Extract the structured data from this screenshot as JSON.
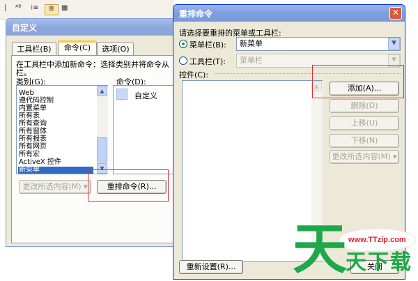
{
  "toolbar": {
    "sep": "|",
    "icon_abc": "ᴬᴮ",
    "icon_list": "⁝≡",
    "icon_grid": "▦"
  },
  "customize": {
    "title": "自定义",
    "tabs": [
      "工具栏(B)",
      "命令(C)",
      "选项(O)"
    ],
    "instruction": "在工具栏中添加新命令：选择类别并将命令从",
    "instruction2": "栏。",
    "category_label": "类别(G):",
    "commands_label": "命令(D):",
    "categories": [
      "Web",
      "遵代码控制",
      "内置菜单",
      "所有表",
      "所有查询",
      "所有窗体",
      "所有报表",
      "所有网页",
      "所有宏",
      "ActiveX 控件",
      "新菜单"
    ],
    "selected_category": "新菜单",
    "command_item": "自定义",
    "modify_selection": "更改所选内容(M) ▾",
    "rearrange_button": "重排命令(R)..."
  },
  "rearrange": {
    "title": "重排命令",
    "close": "✕",
    "prompt": "请选择要重排的菜单或工具栏:",
    "menubar_label": "菜单栏(B):",
    "menubar_value": "新菜单",
    "toolbar_label": "工具栏(T):",
    "toolbar_value": "菜单栏",
    "controls_label": "控件(C):",
    "buttons": {
      "add": "添加(A)...",
      "delete": "删除(D)",
      "move_up": "上移(U)",
      "move_down": "下移(N)",
      "modify": "更改所选内容(M) ▾",
      "reset": "重新设置(R)...",
      "close": "关闭"
    }
  },
  "watermark": {
    "url": "www.TTzip.com",
    "text1": "天",
    "text2": "天下载"
  }
}
